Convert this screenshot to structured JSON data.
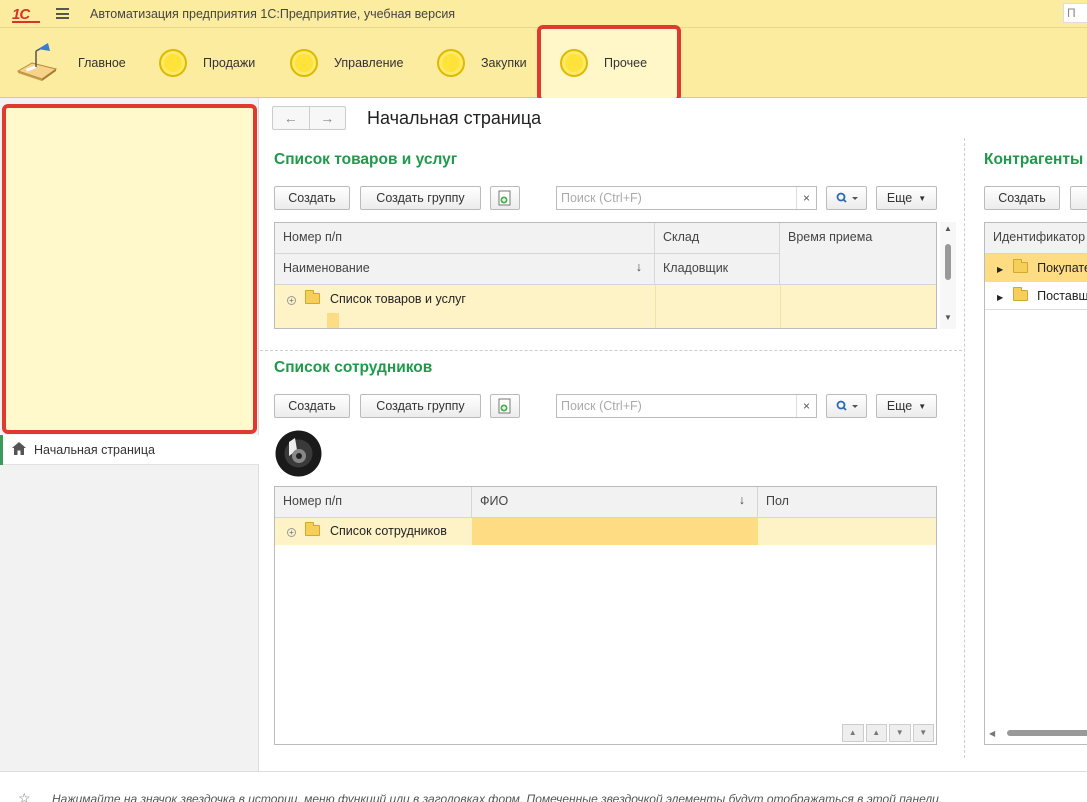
{
  "app": {
    "logo": "1С",
    "title": "Автоматизация предприятия 1С:Предприятие, учебная версия",
    "search_placeholder": "П"
  },
  "sections": [
    {
      "label": "Главное",
      "icon": "desk-lamp-icon"
    },
    {
      "label": "Продажи",
      "icon": "yellow-circle-icon"
    },
    {
      "label": "Управление",
      "icon": "yellow-circle-icon"
    },
    {
      "label": "Закупки",
      "icon": "yellow-circle-icon"
    },
    {
      "label": "Прочее",
      "icon": "yellow-circle-icon",
      "active": true
    }
  ],
  "left_panel": {
    "home_label": "Начальная страница"
  },
  "main": {
    "page_title": "Начальная страница",
    "goods": {
      "title": "Список товаров и услуг",
      "btn_create": "Создать",
      "btn_create_group": "Создать группу",
      "search_placeholder": "Поиск (Ctrl+F)",
      "search_clear": "×",
      "more": "Еще",
      "columns": {
        "num": "Номер п/п",
        "name": "Наименование",
        "warehouse": "Склад",
        "storekeeper": "Кладовщик",
        "time": "Время приема"
      },
      "rows": [
        {
          "name": "Список товаров и услуг"
        }
      ]
    },
    "employees": {
      "title": "Список сотрудников",
      "btn_create": "Создать",
      "btn_create_group": "Создать группу",
      "search_placeholder": "Поиск (Ctrl+F)",
      "search_clear": "×",
      "more": "Еще",
      "columns": {
        "num": "Номер п/п",
        "fio": "ФИО",
        "sex": "Пол"
      },
      "rows": [
        {
          "name": "Список сотрудников"
        }
      ]
    },
    "contractors": {
      "title": "Контрагенты",
      "btn_create": "Создать",
      "columns": {
        "id": "Идентификатор"
      },
      "rows": [
        {
          "name": "Покупатели"
        },
        {
          "name": "Поставщики"
        }
      ]
    }
  },
  "footer": {
    "hint": "Нажимайте на значок звездочка в истории, меню функций или в заголовках форм. Помеченные звездочкой элементы будут отображаться в этой панели."
  },
  "colors": {
    "accent_green": "#1e9a4a",
    "panel_yellow": "#fbeca0",
    "highlight_red": "#e03a2f"
  }
}
